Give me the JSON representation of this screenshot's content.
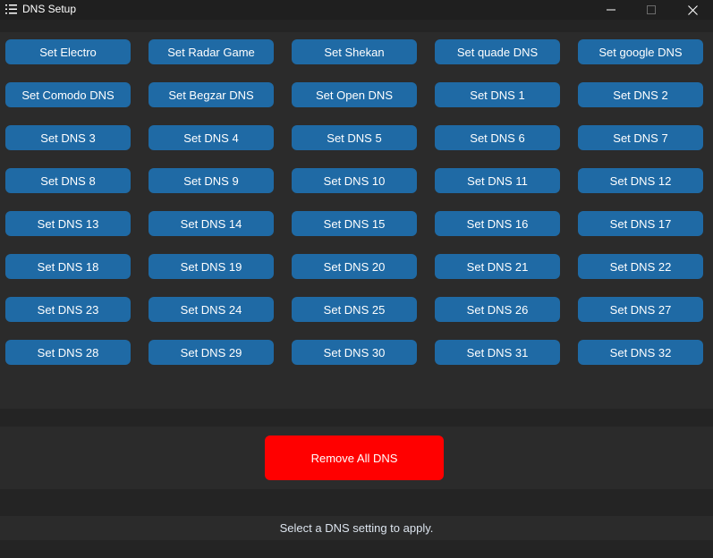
{
  "window": {
    "title": "DNS Setup",
    "icon": "menu-lines-icon",
    "controls": [
      "minimize-icon",
      "maximize-icon",
      "close-icon"
    ]
  },
  "dns_buttons": [
    "Set Electro",
    "Set Radar Game",
    "Set Shekan",
    "Set quade DNS",
    "Set google DNS",
    "Set Comodo DNS",
    "Set Begzar DNS",
    "Set Open DNS",
    "Set DNS 1",
    "Set DNS 2",
    "Set DNS 3",
    "Set DNS 4",
    "Set DNS 5",
    "Set DNS 6",
    "Set DNS 7",
    "Set DNS 8",
    "Set DNS 9",
    "Set DNS 10",
    "Set DNS 11",
    "Set DNS 12",
    "Set DNS 13",
    "Set DNS 14",
    "Set DNS 15",
    "Set DNS 16",
    "Set DNS 17",
    "Set DNS 18",
    "Set DNS 19",
    "Set DNS 20",
    "Set DNS 21",
    "Set DNS 22",
    "Set DNS 23",
    "Set DNS 24",
    "Set DNS 25",
    "Set DNS 26",
    "Set DNS 27",
    "Set DNS 28",
    "Set DNS 29",
    "Set DNS 30",
    "Set DNS 31",
    "Set DNS 32"
  ],
  "remove_button": {
    "label": "Remove All DNS"
  },
  "status": {
    "text": "Select a DNS setting to apply."
  },
  "colors": {
    "button": "#1f6aa5",
    "remove": "#ff0000",
    "background": "#242424",
    "frame": "#2b2b2b"
  }
}
